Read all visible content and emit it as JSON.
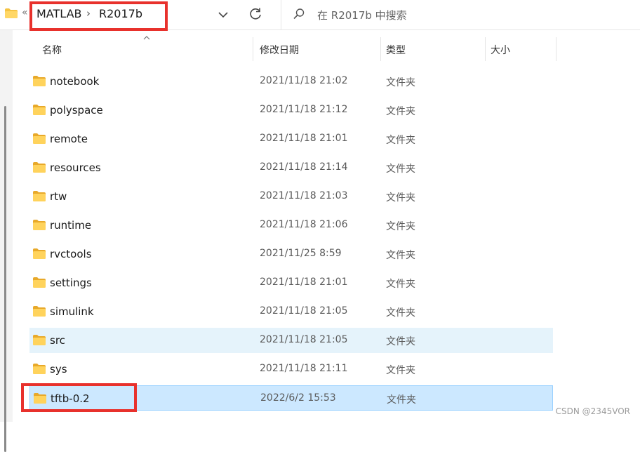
{
  "address": {
    "overflow": "«",
    "breadcrumb": [
      "MATLAB",
      "R2017b"
    ],
    "separator": "›",
    "search_placeholder": "在 R2017b 中搜索"
  },
  "columns": {
    "name": "名称",
    "date": "修改日期",
    "type": "类型",
    "size": "大小"
  },
  "rows": [
    {
      "name": "notebook",
      "date": "2021/11/18 21:02",
      "type": "文件夹",
      "state": "normal"
    },
    {
      "name": "polyspace",
      "date": "2021/11/18 21:12",
      "type": "文件夹",
      "state": "normal"
    },
    {
      "name": "remote",
      "date": "2021/11/18 21:01",
      "type": "文件夹",
      "state": "normal"
    },
    {
      "name": "resources",
      "date": "2021/11/18 21:14",
      "type": "文件夹",
      "state": "normal"
    },
    {
      "name": "rtw",
      "date": "2021/11/18 21:03",
      "type": "文件夹",
      "state": "normal"
    },
    {
      "name": "runtime",
      "date": "2021/11/18 21:06",
      "type": "文件夹",
      "state": "normal"
    },
    {
      "name": "rvctools",
      "date": "2021/11/25 8:59",
      "type": "文件夹",
      "state": "normal"
    },
    {
      "name": "settings",
      "date": "2021/11/18 21:01",
      "type": "文件夹",
      "state": "normal"
    },
    {
      "name": "simulink",
      "date": "2021/11/18 21:05",
      "type": "文件夹",
      "state": "normal"
    },
    {
      "name": "src",
      "date": "2021/11/18 21:05",
      "type": "文件夹",
      "state": "hover"
    },
    {
      "name": "sys",
      "date": "2021/11/18 21:11",
      "type": "文件夹",
      "state": "normal"
    },
    {
      "name": "tftb-0.2",
      "date": "2022/6/2 15:53",
      "type": "文件夹",
      "state": "selected"
    }
  ],
  "watermark": "CSDN @2345VOR",
  "colors": {
    "highlight": "#e8312c",
    "hover": "#e5f3fb",
    "selected": "#cce8ff",
    "folder": "#f5c342"
  }
}
